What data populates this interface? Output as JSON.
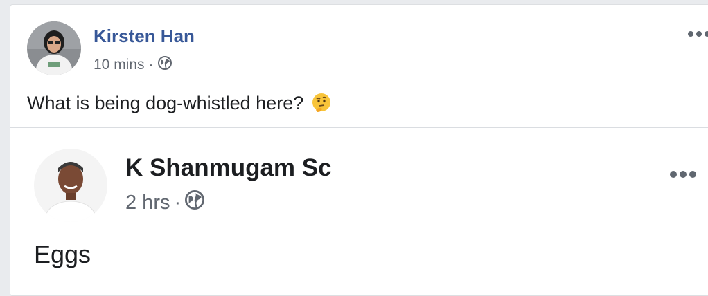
{
  "post": {
    "author": "Kirsten Han",
    "time": "10 mins",
    "separator": "·",
    "privacy_icon": "globe-icon",
    "text": "What is being dog-whistled here?",
    "emoji_icon": "thinking-face-emoji-icon",
    "more_icon": "more-options-icon"
  },
  "shared_post": {
    "author": "K Shanmugam Sc",
    "time": "2 hrs",
    "separator": "·",
    "privacy_icon": "globe-icon",
    "text": "Eggs",
    "more_icon": "more-options-icon"
  },
  "colors": {
    "author_link": "#385898",
    "meta_text": "#616770",
    "body_text": "#1c1e21",
    "page_background": "#e9ebee"
  }
}
